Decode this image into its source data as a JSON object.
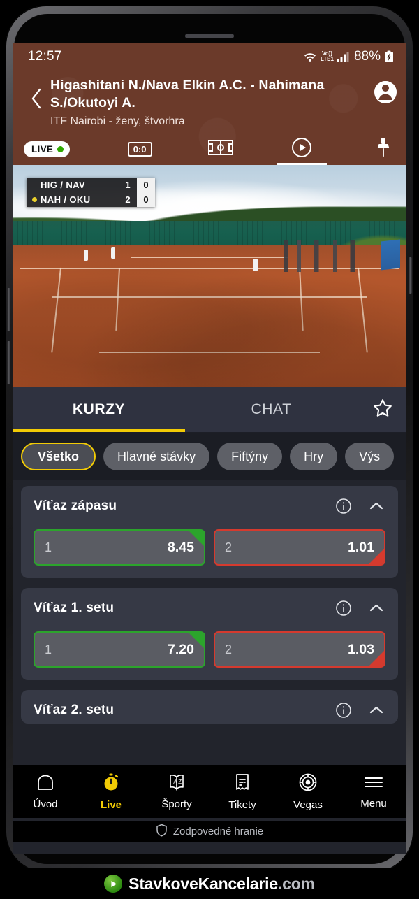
{
  "status_bar": {
    "time": "12:57",
    "network_label": "Vo))",
    "network_label2": "LTE1",
    "battery": "88%"
  },
  "header": {
    "title": "Higashitani N./Nava Elkin A.C. - Nahimana S./Okutoyi A.",
    "subtitle": "ITF Nairobi - ženy, štvorhra",
    "live_badge": "LIVE",
    "score_chip": "0:0",
    "back_icon": "chevron-left-icon",
    "avatar_icon": "user-avatar-icon",
    "pin_icon": "pin-icon",
    "tabs": [
      {
        "name": "scoreboard-tab",
        "label": "0:0",
        "active": false
      },
      {
        "name": "pitch-tab",
        "label": "",
        "active": false
      },
      {
        "name": "video-tab",
        "label": "",
        "active": true
      }
    ]
  },
  "video": {
    "scorebug": {
      "rows": [
        {
          "team": "HIG / NAV",
          "sets": "1",
          "games": "0",
          "serving": false
        },
        {
          "team": "NAH / OKU",
          "sets": "2",
          "games": "0",
          "serving": true
        }
      ]
    }
  },
  "main_tabs": {
    "items": [
      {
        "label": "KURZY",
        "active": true
      },
      {
        "label": "CHAT",
        "active": false
      }
    ],
    "star_icon": "star-outline-icon"
  },
  "filters": {
    "chips": [
      {
        "label": "Všetko",
        "active": true
      },
      {
        "label": "Hlavné stávky",
        "active": false
      },
      {
        "label": "Fiftýny",
        "active": false
      },
      {
        "label": "Hry",
        "active": false
      },
      {
        "label": "Výs",
        "active": false
      }
    ]
  },
  "markets": [
    {
      "title": "Víťaz zápasu",
      "info_icon": "info-icon",
      "collapse_icon": "chevron-up-icon",
      "odds": [
        {
          "label": "1",
          "value": "8.45",
          "trend": "up"
        },
        {
          "label": "2",
          "value": "1.01",
          "trend": "down"
        }
      ]
    },
    {
      "title": "Víťaz 1. setu",
      "info_icon": "info-icon",
      "collapse_icon": "chevron-up-icon",
      "odds": [
        {
          "label": "1",
          "value": "7.20",
          "trend": "up"
        },
        {
          "label": "2",
          "value": "1.03",
          "trend": "down"
        }
      ]
    },
    {
      "title": "Víťaz 2. setu",
      "info_icon": "info-icon",
      "collapse_icon": "chevron-up-icon",
      "odds": []
    }
  ],
  "bottom_nav": {
    "items": [
      {
        "label": "Úvod",
        "icon": "home-icon",
        "active": false
      },
      {
        "label": "Live",
        "icon": "stopwatch-icon",
        "active": true
      },
      {
        "label": "Športy",
        "icon": "az-book-icon",
        "active": false
      },
      {
        "label": "Tikety",
        "icon": "receipt-icon",
        "active": false
      },
      {
        "label": "Vegas",
        "icon": "chip-icon",
        "active": false
      },
      {
        "label": "Menu",
        "icon": "hamburger-icon",
        "active": false
      }
    ]
  },
  "responsible_gaming": {
    "label": "Zodpovedné hranie",
    "icon": "shield-icon"
  },
  "watermark": {
    "name": "StavkoveKancelarie",
    "tld": ".com",
    "icon": "play-circle-icon"
  },
  "colors": {
    "header_brown": "#6B3A2A",
    "accent_yellow": "#F2CB05",
    "page_bg": "#22242C",
    "card_bg": "#363945",
    "odd_bg": "#5A5C63",
    "up_green": "#2CA42C",
    "down_red": "#D53A2E"
  }
}
